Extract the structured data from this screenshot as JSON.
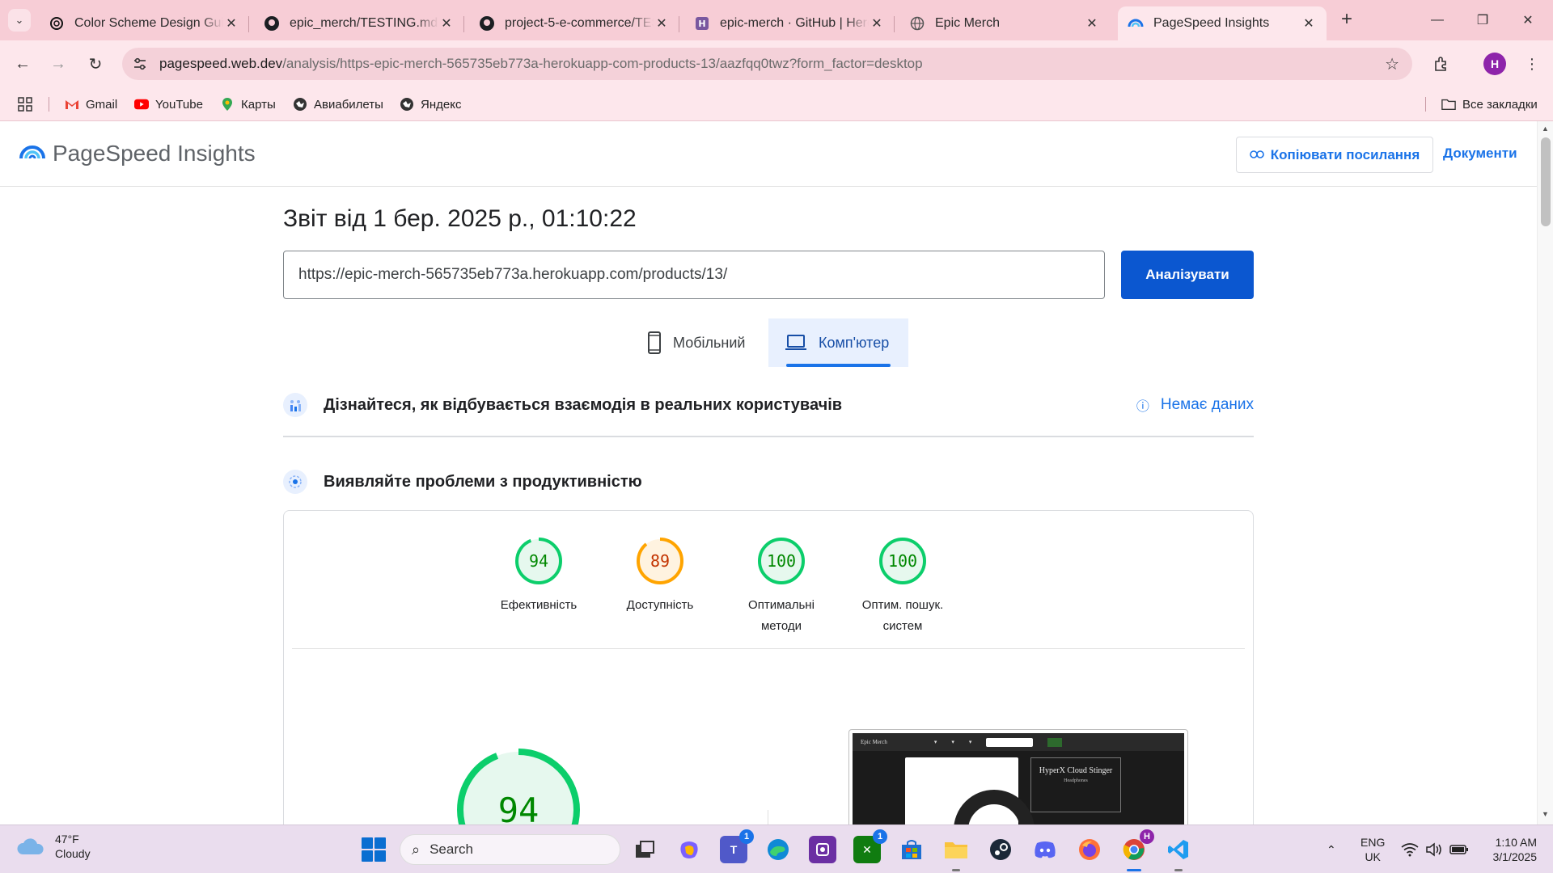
{
  "browser": {
    "tabs": [
      {
        "title": "Color Scheme Design Guid",
        "icon": "openai-icon"
      },
      {
        "title": "epic_merch/TESTING.md at",
        "icon": "github-icon"
      },
      {
        "title": "project-5-e-commerce/TES",
        "icon": "github-icon"
      },
      {
        "title": "epic-merch · GitHub | Hero",
        "icon": "heroku-icon"
      },
      {
        "title": "Epic Merch",
        "icon": "globe-icon"
      },
      {
        "title": "PageSpeed Insights",
        "icon": "pagespeed-icon"
      }
    ],
    "url_host": "pagespeed.web.dev",
    "url_path": "/analysis/https-epic-merch-565735eb773a-herokuapp-com-products-13/aazfqq0twz?form_factor=desktop",
    "profile_initial": "H",
    "bookmarks": [
      {
        "label": "Gmail",
        "icon": "gmail-icon"
      },
      {
        "label": "YouTube",
        "icon": "youtube-icon"
      },
      {
        "label": "Карты",
        "icon": "maps-icon"
      },
      {
        "label": "Авиабилеты",
        "icon": "globe-icon"
      },
      {
        "label": "Яндекс",
        "icon": "globe-icon"
      }
    ],
    "all_bookmarks": "Все закладки"
  },
  "psi": {
    "brand": "PageSpeed Insights",
    "copy_link": "Копіювати посилання",
    "docs": "Документи",
    "report_title": "Звіт від 1 бер. 2025 р., 01:10:22",
    "url_value": "https://epic-merch-565735eb773a.herokuapp.com/products/13/",
    "analyze": "Аналізувати",
    "device_tabs": [
      {
        "label": "Мобільний",
        "active": false
      },
      {
        "label": "Комп'ютер",
        "active": true
      }
    ],
    "field_data": {
      "heading": "Дізнайтеся, як відбувається взаємодія в реальних користувачів",
      "status": "Немає даних"
    },
    "lab_data": {
      "heading": "Виявляйте проблеми з продуктивністю"
    },
    "scores": [
      {
        "value": 94,
        "label_lines": [
          "Ефективність"
        ],
        "color": "#0cce6b",
        "bg": "#e6f8ee",
        "text_color": "#008800"
      },
      {
        "value": 89,
        "label_lines": [
          "Доступність"
        ],
        "color": "#ffa400",
        "bg": "#fff3e0",
        "text_color": "#c33300"
      },
      {
        "value": 100,
        "label_lines": [
          "Оптимальні",
          "методи"
        ],
        "color": "#0cce6b",
        "bg": "#e6f8ee",
        "text_color": "#008800"
      },
      {
        "value": 100,
        "label_lines": [
          "Оптим. пошук.",
          "систем"
        ],
        "color": "#0cce6b",
        "bg": "#e6f8ee",
        "text_color": "#008800"
      }
    ],
    "main_score": 94,
    "screenshot": {
      "brand": "Epic Merch",
      "product_title": "HyperX Cloud Stinger",
      "product_sub": "Headphones"
    }
  },
  "taskbar": {
    "weather_temp": "47°F",
    "weather_desc": "Cloudy",
    "search_placeholder": "Search",
    "lang_1": "ENG",
    "lang_2": "UK",
    "time": "1:10 AM",
    "date": "3/1/2025",
    "badge_teams": "1",
    "badge_xbox": "1"
  }
}
